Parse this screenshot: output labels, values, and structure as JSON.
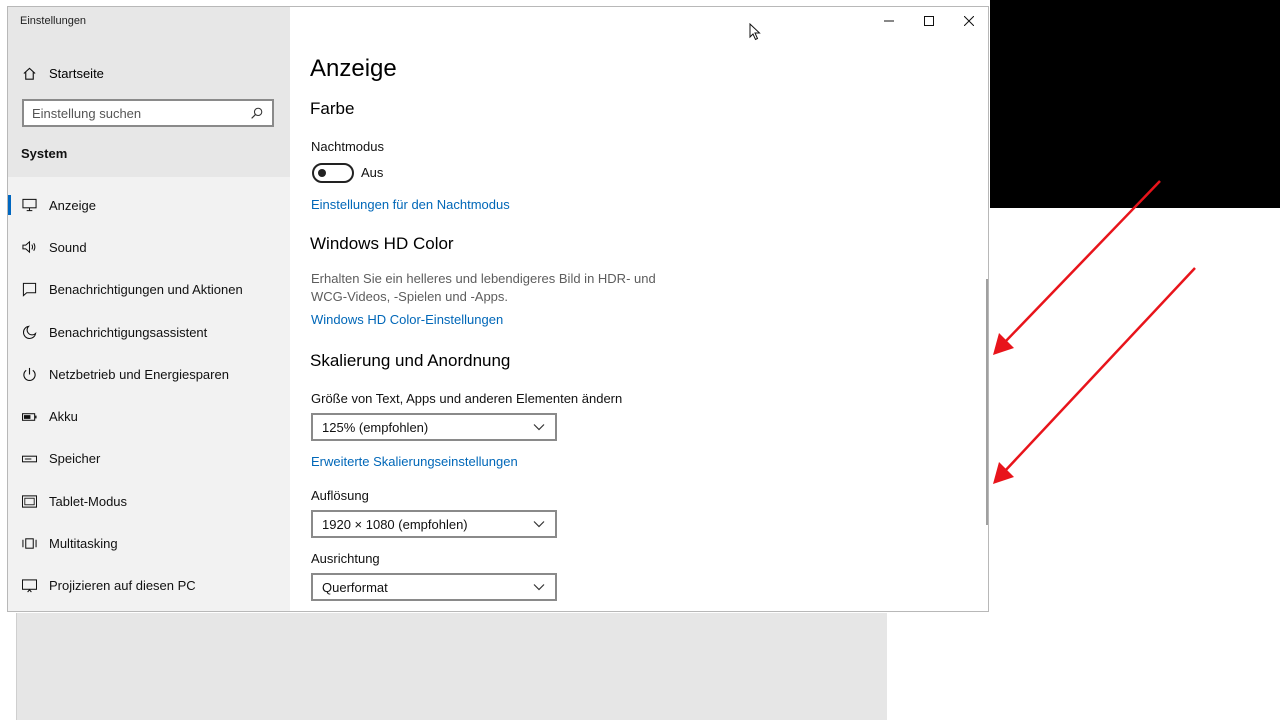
{
  "window": {
    "title": "Einstellungen"
  },
  "sidebar": {
    "home_label": "Startseite",
    "search_placeholder": "Einstellung suchen",
    "section_label": "System",
    "items": [
      {
        "label": "Anzeige",
        "icon": "monitor-icon",
        "active": true
      },
      {
        "label": "Sound",
        "icon": "speaker-icon"
      },
      {
        "label": "Benachrichtigungen und Aktionen",
        "icon": "message-icon"
      },
      {
        "label": "Benachrichtigungsassistent",
        "icon": "moon-icon"
      },
      {
        "label": "Netzbetrieb und Energiesparen",
        "icon": "power-icon"
      },
      {
        "label": "Akku",
        "icon": "battery-icon"
      },
      {
        "label": "Speicher",
        "icon": "storage-icon"
      },
      {
        "label": "Tablet-Modus",
        "icon": "tablet-icon"
      },
      {
        "label": "Multitasking",
        "icon": "multitasking-icon"
      },
      {
        "label": "Projizieren auf diesen PC",
        "icon": "projector-icon"
      }
    ]
  },
  "main": {
    "title": "Anzeige",
    "color_heading": "Farbe",
    "night_mode_label": "Nachtmodus",
    "night_mode_state": "Aus",
    "night_mode_link": "Einstellungen für den Nachtmodus",
    "hdr_heading": "Windows HD Color",
    "hdr_description": "Erhalten Sie ein helleres und lebendigeres Bild in HDR- und WCG-Videos, -Spielen und -Apps.",
    "hdr_link": "Windows HD Color-Einstellungen",
    "scaling_heading": "Skalierung und Anordnung",
    "scale_label": "Größe von Text, Apps und anderen Elementen ändern",
    "scale_value": "125% (empfohlen)",
    "advanced_scaling_link": "Erweiterte Skalierungseinstellungen",
    "resolution_label": "Auflösung",
    "resolution_value": "1920 × 1080 (empfohlen)",
    "orientation_label": "Ausrichtung",
    "orientation_value": "Querformat"
  },
  "colors": {
    "accent": "#0067b8",
    "annotation_arrow": "#e8141b"
  }
}
